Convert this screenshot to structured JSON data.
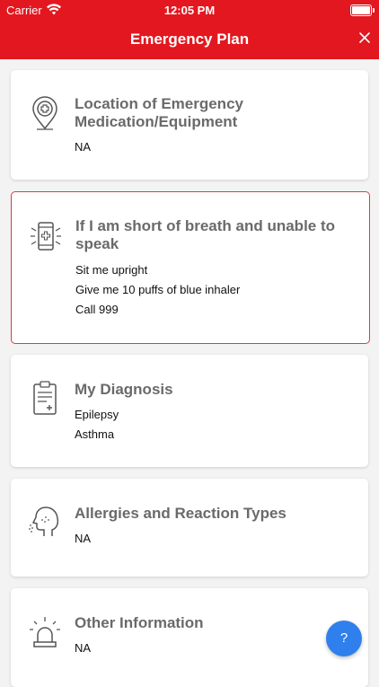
{
  "status_bar": {
    "carrier": "Carrier",
    "time": "12:05 PM"
  },
  "nav": {
    "title": "Emergency Plan",
    "close_icon": "close-icon"
  },
  "cards": [
    {
      "title": "Location of Emergency Medication/Equipment",
      "icon": "location-pin-medical-icon",
      "lines": [
        "NA"
      ]
    },
    {
      "title": "If I am short of breath and unable to speak",
      "icon": "phone-alert-icon",
      "lines": [
        "Sit me upright",
        "Give me 10 puffs of blue inhaler",
        "Call 999"
      ]
    },
    {
      "title": "My Diagnosis",
      "icon": "clipboard-medical-icon",
      "lines": [
        "Epilepsy",
        "Asthma"
      ]
    },
    {
      "title": "Allergies and Reaction Types",
      "icon": "head-sneeze-icon",
      "lines": [
        "NA"
      ]
    },
    {
      "title": "Other Information",
      "icon": "siren-icon",
      "lines": [
        "NA"
      ]
    }
  ],
  "help_button": {
    "label": "?"
  },
  "colors": {
    "header": "#e3171f",
    "highlight_border": "#e03a3f",
    "help_button": "#2f80ed"
  }
}
